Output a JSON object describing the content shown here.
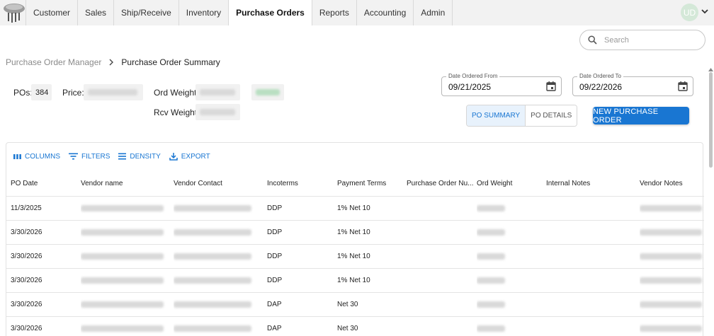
{
  "nav": {
    "tabs": [
      {
        "label": "Customer"
      },
      {
        "label": "Sales"
      },
      {
        "label": "Ship/Receive"
      },
      {
        "label": "Inventory"
      },
      {
        "label": "Purchase Orders",
        "active": true
      },
      {
        "label": "Reports"
      },
      {
        "label": "Accounting"
      },
      {
        "label": "Admin"
      }
    ],
    "avatar_initials": "UD"
  },
  "search": {
    "placeholder": "Search"
  },
  "breadcrumb": {
    "parent": "Purchase Order Manager",
    "current": "Purchase Order Summary"
  },
  "summary": {
    "pos_label": "POs:",
    "pos_value": "384",
    "price_label": "Price:",
    "ord_weight_label": "Ord Weight:",
    "rcv_weight_label": "Rcv Weight:"
  },
  "filters": {
    "date_from_label": "Date Ordered From",
    "date_from_value": "09/21/2025",
    "date_to_label": "Date Ordered To",
    "date_to_value": "09/22/2026"
  },
  "view_toggle": {
    "summary_label": "PO SUMMARY",
    "details_label": "PO DETAILS",
    "selected": "summary"
  },
  "new_po_label": "NEW PURCHASE ORDER",
  "grid_toolbar": {
    "columns": "COLUMNS",
    "filters": "FILTERS",
    "density": "DENSITY",
    "export": "EXPORT"
  },
  "columns": [
    "PO Date",
    "Vendor name",
    "Vendor Contact",
    "Incoterms",
    "Payment Terms",
    "Purchase Order Nu...",
    "Ord Weight",
    "Internal Notes",
    "Vendor Notes"
  ],
  "rows": [
    {
      "po_date": "11/3/2025",
      "incoterms": "DDP",
      "payment_terms": "1% Net 10"
    },
    {
      "po_date": "3/30/2026",
      "incoterms": "DDP",
      "payment_terms": "1% Net 10"
    },
    {
      "po_date": "3/30/2026",
      "incoterms": "DDP",
      "payment_terms": "1% Net 10"
    },
    {
      "po_date": "3/30/2026",
      "incoterms": "DDP",
      "payment_terms": "1% Net 10"
    },
    {
      "po_date": "3/30/2026",
      "incoterms": "DAP",
      "payment_terms": "Net 30"
    },
    {
      "po_date": "3/30/2026",
      "incoterms": "DAP",
      "payment_terms": "Net 30"
    }
  ],
  "colors": {
    "primary": "#1976d2",
    "avatar": "#d4e8d8",
    "topbar": "#f2f2f2",
    "redacted": "#d9d9d9"
  },
  "icons": {
    "search": "search-icon",
    "calendar": "calendar-icon",
    "columns": "columns-icon",
    "filters": "filter-icon",
    "density": "density-icon",
    "export": "export-icon",
    "breadcrumb_separator": "chevron-right-icon",
    "avatar_menu": "chevron-down-icon"
  }
}
